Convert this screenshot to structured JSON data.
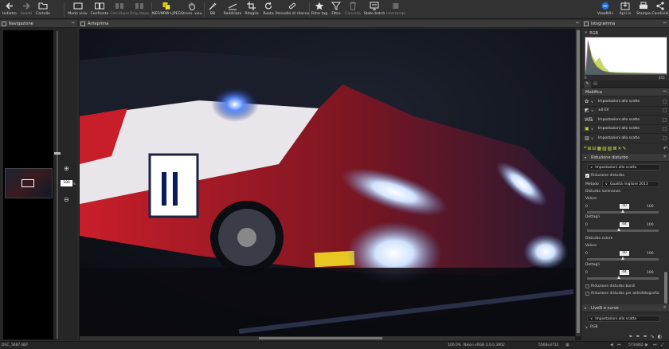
{
  "toolbar": {
    "items": [
      {
        "label": "Indietro",
        "icon": "back-arrow-icon",
        "enabled": true
      },
      {
        "label": "Avanti",
        "icon": "forward-arrow-icon",
        "enabled": false
      },
      {
        "label": "Cartelle",
        "icon": "folder-icon",
        "enabled": true
      },
      {
        "label": "Modo visiv.",
        "icon": "view-mode-icon",
        "enabled": true
      },
      {
        "label": "Confronta",
        "icon": "compare-icon",
        "enabled": true
      },
      {
        "label": "Corr./dopo",
        "icon": "before-after-icon",
        "enabled": false
      },
      {
        "label": "Orig./dopo",
        "icon": "original-after-icon",
        "enabled": false
      },
      {
        "label": "NEF/NRW+JPEG",
        "icon": "nef-jpeg-icon",
        "enabled": true
      },
      {
        "label": "Strum. visu.",
        "icon": "hand-tool-icon",
        "enabled": true
      },
      {
        "label": "BB",
        "icon": "eyedropper-icon",
        "enabled": true
      },
      {
        "label": "Raddrizza",
        "icon": "straighten-icon",
        "enabled": true
      },
      {
        "label": "Ritaglia",
        "icon": "crop-icon",
        "enabled": true
      },
      {
        "label": "Ruota",
        "icon": "rotate-icon",
        "enabled": true
      },
      {
        "label": "Pennello di ritocco",
        "icon": "retouch-brush-icon",
        "enabled": true
      },
      {
        "label": "Filtro tag",
        "icon": "star-icon",
        "enabled": true
      },
      {
        "label": "Filtro",
        "icon": "filter-icon",
        "enabled": true
      },
      {
        "label": "Cancella",
        "icon": "trash-icon",
        "enabled": false
      },
      {
        "label": "Stato batch",
        "icon": "batch-status-icon",
        "enabled": true
      },
      {
        "label": "Interrompi",
        "icon": "stop-icon",
        "enabled": false
      },
      {
        "label": "ViewNX-i",
        "icon": "viewnx-icon",
        "enabled": true
      },
      {
        "label": "Apri in",
        "icon": "open-in-icon",
        "enabled": true
      },
      {
        "label": "Stampa",
        "icon": "print-icon",
        "enabled": true
      },
      {
        "label": "Condividi",
        "icon": "share-icon",
        "enabled": true
      }
    ]
  },
  "navigation": {
    "title": "Navigazione",
    "zoom_value": "100"
  },
  "preview": {
    "title": "Anteprima"
  },
  "histogram": {
    "title": "Istogramma",
    "channel": "RGB",
    "scale_min": "0",
    "scale_max": "255"
  },
  "adjust": {
    "title": "Modifica",
    "rows": [
      {
        "value": "Impostazioni allo scatto"
      },
      {
        "value": "±0 EV"
      },
      {
        "value": "Impostazioni allo scatto"
      },
      {
        "value": "Impostazioni allo scatto"
      },
      {
        "value": "Impostazioni allo scatto"
      }
    ]
  },
  "noise": {
    "title": "Riduzione disturbo",
    "preset": "Impostazioni allo scatto",
    "checkbox_label": "Riduzione disturbo",
    "method_label": "Metodo",
    "method_value": "Qualità migliore 2013",
    "luminance_title": "Disturbo luminanza",
    "color_title": "Disturbo colore",
    "value_label": "Valore",
    "detail_label": "Dettagli",
    "scale_min": "0",
    "scale_max": "100",
    "lum_value": "50",
    "lum_detail": "44",
    "col_value": "50",
    "col_detail": "44",
    "edge_label": "Riduzione disturbo bordi",
    "astro_label": "Riduzione disturbo per astrofotografia"
  },
  "levels": {
    "title": "Livelli e curve",
    "preset": "Impostazioni allo scatto",
    "channel": "RGB"
  },
  "status": {
    "filename": "DSC_1887.NEF",
    "zoom": "100.0%",
    "info": "Nikon sRGB 4.0.0.3002",
    "dimensions": "5568x3712",
    "counter": "573/862"
  },
  "colors": {
    "accent": "#e8a735",
    "bg": "#2b2b2b",
    "panel": "#2d2d2d",
    "header": "#3a3a3a"
  }
}
